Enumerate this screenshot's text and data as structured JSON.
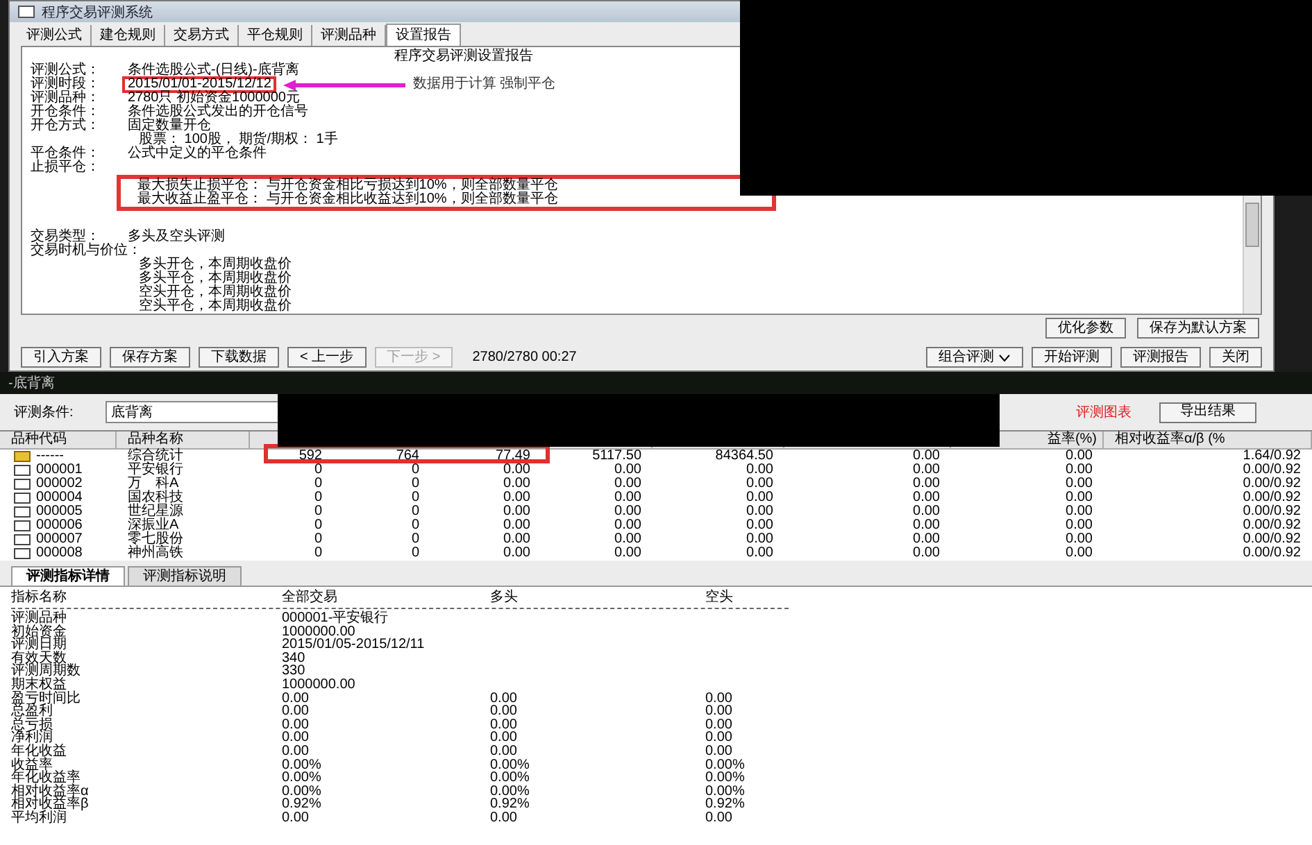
{
  "window": {
    "title": "程序交易评测系统"
  },
  "tabs": [
    {
      "label": "评测公式",
      "selected": false
    },
    {
      "label": "建仓规则",
      "selected": false
    },
    {
      "label": "交易方式",
      "selected": false
    },
    {
      "label": "平仓规则",
      "selected": false
    },
    {
      "label": "评测品种",
      "selected": false
    },
    {
      "label": "设置报告",
      "selected": true
    }
  ],
  "report": {
    "title": "程序交易评测设置报告",
    "lines": [
      {
        "kind": "field",
        "label": "评测公式：",
        "value": "条件选股公式-(日线)-底背离"
      },
      {
        "kind": "field",
        "label": "评测时段：",
        "value": "2015/01/01-2015/12/12",
        "marked": true,
        "note": "数据用于计算  强制平仓"
      },
      {
        "kind": "field",
        "label": "评测品种：",
        "value": "2780只  初始资金1000000元"
      },
      {
        "kind": "field",
        "label": "开仓条件：",
        "value": "条件选股公式发出的开仓信号"
      },
      {
        "kind": "field",
        "label": "开仓方式：",
        "value": "固定数量开仓"
      },
      {
        "kind": "detail",
        "value": "股票： 100股， 期货/期权： 1手"
      },
      {
        "kind": "field",
        "label": "平仓条件：",
        "value": "公式中定义的平仓条件"
      },
      {
        "kind": "field",
        "label": "止损平仓："
      },
      {
        "kind": "boxed",
        "items": [
          "最大损失止损平仓： 与开仓资金相比亏损达到10%，则全部数量平仓",
          "最大收益止盈平仓： 与开仓资金相比收益达到10%，则全部数量平仓"
        ]
      },
      {
        "kind": "gap"
      },
      {
        "kind": "field",
        "label": "交易类型：",
        "value": "多头及空头评测"
      },
      {
        "kind": "field",
        "label": "交易时机与价位："
      },
      {
        "kind": "detail",
        "value": "多头开仓，本周期收盘价"
      },
      {
        "kind": "detail",
        "value": "多头平仓，本周期收盘价"
      },
      {
        "kind": "detail",
        "value": "空头开仓，本周期收盘价"
      },
      {
        "kind": "detail",
        "value": "空头平仓，本周期收盘价"
      }
    ]
  },
  "option_buttons": [
    "优化参数",
    "保存为默认方案"
  ],
  "toolbar": {
    "left": [
      {
        "label": "引入方案",
        "disabled": false
      },
      {
        "label": "保存方案",
        "disabled": false
      },
      {
        "label": "下载数据",
        "disabled": false
      },
      {
        "label": "< 上一步",
        "disabled": false
      },
      {
        "label": "下一步 >",
        "disabled": true
      }
    ],
    "status": "2780/2780  00:27",
    "right": [
      {
        "label": "组合评测",
        "kind": "dropdown"
      },
      {
        "label": "开始评测",
        "kind": "button"
      },
      {
        "label": "评测报告",
        "kind": "button"
      },
      {
        "label": "关闭",
        "kind": "button"
      }
    ]
  },
  "strategy_bar": {
    "title": "-底背离"
  },
  "condition": {
    "label": "评测条件:",
    "value": "底背离"
  },
  "chart_link": "评测图表",
  "export_button": "导出结果",
  "results": {
    "headers": {
      "code": "品种代码",
      "name": "品种名称",
      "column_9": "益率(%)",
      "column_10": "相对收益率α/β (%"
    },
    "rows": [
      {
        "kind": "summary",
        "marked": true,
        "code": "------",
        "name": "综合统计",
        "cells": [
          "592",
          "764",
          "77.49",
          "5117.50",
          "84364.50",
          "0.00",
          "0.00",
          "1.64/0.92"
        ]
      },
      {
        "kind": "stock",
        "marked": false,
        "code": "000001",
        "name": "平安银行",
        "cells": [
          "0",
          "0",
          "0.00",
          "0.00",
          "0.00",
          "0.00",
          "0.00",
          "0.00/0.92"
        ]
      },
      {
        "kind": "stock",
        "marked": false,
        "code": "000002",
        "name": "万　科A",
        "cells": [
          "0",
          "0",
          "0.00",
          "0.00",
          "0.00",
          "0.00",
          "0.00",
          "0.00/0.92"
        ]
      },
      {
        "kind": "stock",
        "marked": false,
        "code": "000004",
        "name": "国农科技",
        "cells": [
          "0",
          "0",
          "0.00",
          "0.00",
          "0.00",
          "0.00",
          "0.00",
          "0.00/0.92"
        ]
      },
      {
        "kind": "stock",
        "marked": false,
        "code": "000005",
        "name": "世纪星源",
        "cells": [
          "0",
          "0",
          "0.00",
          "0.00",
          "0.00",
          "0.00",
          "0.00",
          "0.00/0.92"
        ]
      },
      {
        "kind": "stock",
        "marked": false,
        "code": "000006",
        "name": "深振业A",
        "cells": [
          "0",
          "0",
          "0.00",
          "0.00",
          "0.00",
          "0.00",
          "0.00",
          "0.00/0.92"
        ]
      },
      {
        "kind": "stock",
        "marked": false,
        "code": "000007",
        "name": "零七股份",
        "cells": [
          "0",
          "0",
          "0.00",
          "0.00",
          "0.00",
          "0.00",
          "0.00",
          "0.00/0.92"
        ]
      },
      {
        "kind": "stock",
        "marked": false,
        "code": "000008",
        "name": "神州高铁",
        "cells": [
          "0",
          "0",
          "0.00",
          "0.00",
          "0.00",
          "0.00",
          "0.00",
          "0.00/0.92"
        ]
      }
    ]
  },
  "detail_tabs": [
    {
      "label": "评测指标详情",
      "selected": true
    },
    {
      "label": "评测指标说明",
      "selected": false
    }
  ],
  "indicators": {
    "columns": [
      "指标名称",
      "全部交易",
      "多头",
      "空头"
    ],
    "rows": [
      {
        "name": "评测品种",
        "values": [
          "000001-平安银行"
        ]
      },
      {
        "name": "初始资金",
        "values": [
          "1000000.00"
        ]
      },
      {
        "name": "评测日期",
        "values": [
          "2015/01/05-2015/12/11"
        ]
      },
      {
        "name": "有效天数",
        "values": [
          "340"
        ]
      },
      {
        "name": "评测周期数",
        "values": [
          "330"
        ]
      },
      {
        "name": "期末权益",
        "values": [
          "1000000.00"
        ]
      },
      {
        "name": "盈亏时间比",
        "values": [
          "0.00",
          "0.00",
          "0.00"
        ]
      },
      {
        "name": "总盈利",
        "values": [
          "0.00",
          "0.00",
          "0.00"
        ]
      },
      {
        "name": "总亏损",
        "values": [
          "0.00",
          "0.00",
          "0.00"
        ]
      },
      {
        "name": "净利润",
        "values": [
          "0.00",
          "0.00",
          "0.00"
        ]
      },
      {
        "name": "年化收益",
        "values": [
          "0.00",
          "0.00",
          "0.00"
        ]
      },
      {
        "name": "收益率",
        "values": [
          "0.00%",
          "0.00%",
          "0.00%"
        ]
      },
      {
        "name": "年化收益率",
        "values": [
          "0.00%",
          "0.00%",
          "0.00%"
        ]
      },
      {
        "name": "相对收益率α",
        "values": [
          "0.00%",
          "0.00%",
          "0.00%"
        ]
      },
      {
        "name": "相对收益率β",
        "values": [
          "0.92%",
          "0.92%",
          "0.92%"
        ]
      },
      {
        "name": "平均利润",
        "values": [
          "0.00",
          "0.00",
          "0.00"
        ]
      }
    ]
  }
}
